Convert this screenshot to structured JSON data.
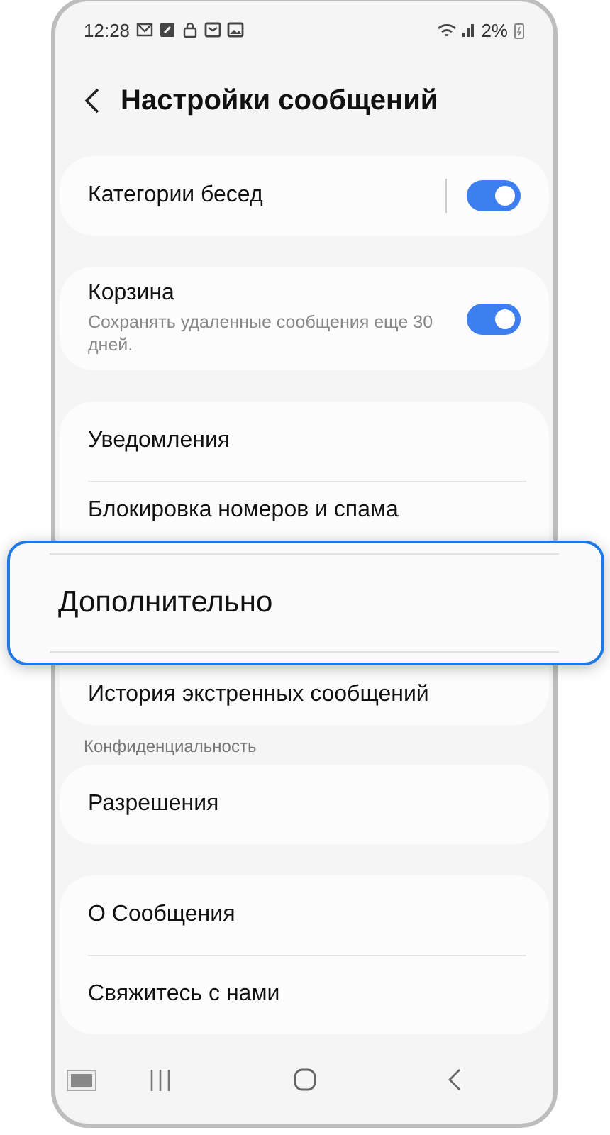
{
  "status_bar": {
    "time": "12:28",
    "battery": "2%"
  },
  "header": {
    "title": "Настройки сообщений"
  },
  "groups": [
    {
      "items": [
        {
          "kind": "toggle",
          "label": "Категории бесед",
          "on": true,
          "split": true
        }
      ]
    },
    {
      "items": [
        {
          "kind": "toggle",
          "label": "Корзина",
          "description": "Сохранять удаленные сообщения еще 30 дней.",
          "on": true,
          "split": false
        }
      ]
    },
    {
      "items": [
        {
          "kind": "link",
          "label": "Уведомления",
          "highlighted": false
        },
        {
          "kind": "link",
          "label": "Блокировка номеров и спама",
          "highlighted": false
        },
        {
          "kind": "link",
          "label": "Дополнительно",
          "highlighted": true
        },
        {
          "kind": "link",
          "label": "История экстренных сообщений",
          "highlighted": false
        }
      ]
    },
    {
      "header": "Конфиденциальность",
      "items": [
        {
          "kind": "link",
          "label": "Разрешения",
          "highlighted": false
        }
      ]
    },
    {
      "items": [
        {
          "kind": "link",
          "label": "О Сообщения",
          "highlighted": false
        },
        {
          "kind": "link",
          "label": "Свяжитесь с нами",
          "highlighted": false
        }
      ]
    }
  ]
}
